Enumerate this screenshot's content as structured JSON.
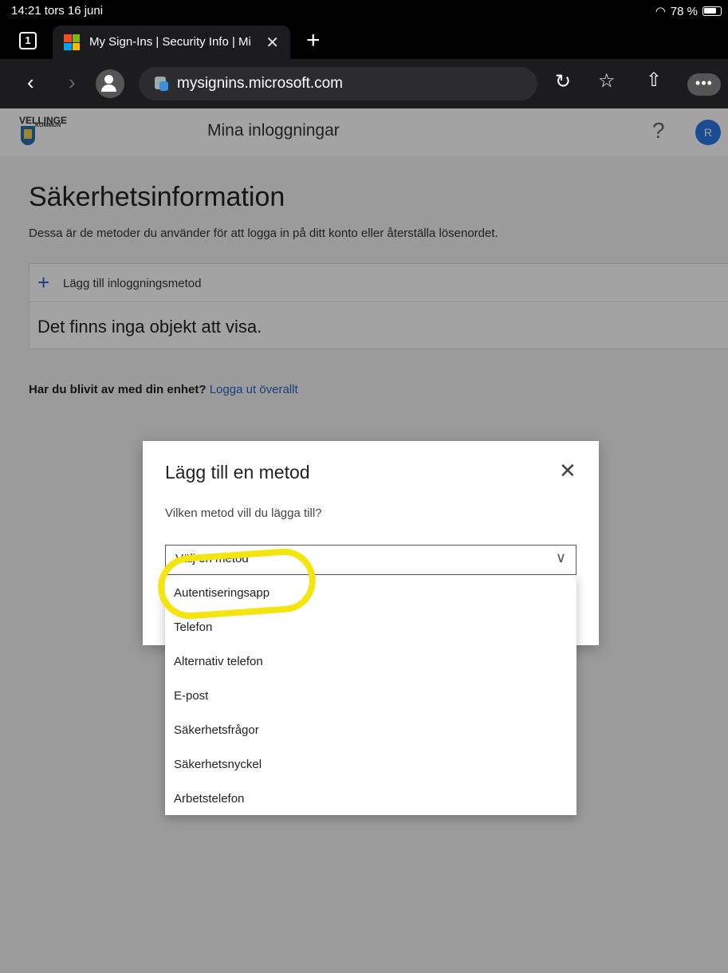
{
  "status_bar": {
    "time_date": "14:21  tors 16 juni",
    "battery": "78 %"
  },
  "browser": {
    "tab_count": "1",
    "tab_title": "My Sign-Ins | Security Info | Mi",
    "url": "mysignins.microsoft.com",
    "more_label": "•••"
  },
  "header": {
    "org_name": "VELLINGE",
    "org_sub": "KOMMUN",
    "title": "Mina inloggningar",
    "help": "?",
    "avatar_initial": "R"
  },
  "main": {
    "title": "Säkerhetsinformation",
    "description": "Dessa är de metoder du använder för att logga in på ditt konto eller återställa lösenordet.",
    "add_method": "Lägg till inloggningsmetod",
    "empty": "Det finns inga objekt att visa.",
    "lost_prompt": "Har du blivit av med din enhet?",
    "logout_link": "Logga ut överallt"
  },
  "modal": {
    "title": "Lägg till en metod",
    "question": "Vilken metod vill du lägga till?",
    "select_placeholder": "Välj en metod",
    "options": [
      "Autentiseringsapp",
      "Telefon",
      "Alternativ telefon",
      "E-post",
      "Säkerhetsfrågor",
      "Säkerhetsnyckel",
      "Arbetstelefon"
    ]
  }
}
